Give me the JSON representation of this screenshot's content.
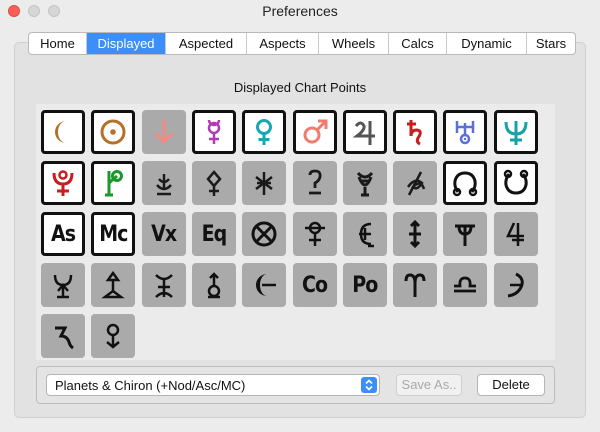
{
  "window": {
    "title": "Preferences"
  },
  "tabs": [
    {
      "label": "Home"
    },
    {
      "label": "Displayed"
    },
    {
      "label": "Aspected"
    },
    {
      "label": "Aspects"
    },
    {
      "label": "Wheels"
    },
    {
      "label": "Calcs"
    },
    {
      "label": "Dynamic"
    },
    {
      "label": "Stars"
    }
  ],
  "active_tab": "Displayed",
  "section": {
    "title": "Displayed Chart Points"
  },
  "chart_points": [
    {
      "symbol": "moon-glyph",
      "enabled": true,
      "color": "#b5702a"
    },
    {
      "symbol": "sun-glyph",
      "enabled": true,
      "color": "#b5702a"
    },
    {
      "symbol": "earth-glyph",
      "enabled": false,
      "color": "#f28a84"
    },
    {
      "symbol": "mercury-glyph",
      "enabled": true,
      "color": "#b23ab5"
    },
    {
      "symbol": "venus-glyph",
      "enabled": true,
      "color": "#1aa7b3"
    },
    {
      "symbol": "mars-glyph",
      "enabled": true,
      "color": "#f07c6e"
    },
    {
      "symbol": "jupiter-glyph",
      "enabled": true,
      "color": "#555555"
    },
    {
      "symbol": "saturn-glyph",
      "enabled": true,
      "color": "#c81e1e"
    },
    {
      "symbol": "uranus-glyph",
      "enabled": true,
      "color": "#5a6fd8"
    },
    {
      "symbol": "neptune-glyph",
      "enabled": true,
      "color": "#17a2a8"
    },
    {
      "symbol": "pluto-glyph",
      "enabled": true,
      "color": "#c81e1e"
    },
    {
      "symbol": "chiron-glyph",
      "enabled": true,
      "color": "#1a9a2a"
    },
    {
      "symbol": "ceres-glyph",
      "enabled": false,
      "color": "#1a1a1a"
    },
    {
      "symbol": "pallas-glyph",
      "enabled": false,
      "color": "#1a1a1a"
    },
    {
      "symbol": "juno-glyph",
      "enabled": false,
      "color": "#1a1a1a"
    },
    {
      "symbol": "vesta-glyph",
      "enabled": false,
      "color": "#1a1a1a"
    },
    {
      "symbol": "lilith-glyph",
      "enabled": false,
      "color": "#1a1a1a"
    },
    {
      "symbol": "fortune-glyph",
      "enabled": false,
      "color": "#1a1a1a"
    },
    {
      "symbol": "north-node-glyph",
      "enabled": true,
      "color": "#111111"
    },
    {
      "symbol": "south-node-glyph",
      "enabled": true,
      "color": "#111111"
    },
    {
      "symbol": "ascendant-glyph",
      "label": "As",
      "enabled": true,
      "color": "#111111"
    },
    {
      "symbol": "midheaven-glyph",
      "label": "Mc",
      "enabled": true,
      "color": "#111111"
    },
    {
      "symbol": "vertex-glyph",
      "label": "Vx",
      "enabled": false,
      "color": "#111111"
    },
    {
      "symbol": "east-point-glyph",
      "label": "Eq",
      "enabled": false,
      "color": "#111111"
    },
    {
      "symbol": "part-glyph",
      "enabled": false,
      "color": "#111111"
    },
    {
      "symbol": "hades-glyph",
      "enabled": false,
      "color": "#111111"
    },
    {
      "symbol": "cupido-glyph",
      "enabled": false,
      "color": "#111111"
    },
    {
      "symbol": "zeus-glyph",
      "enabled": false,
      "color": "#111111"
    },
    {
      "symbol": "kronos-glyph",
      "enabled": false,
      "color": "#111111"
    },
    {
      "symbol": "apollon-glyph",
      "enabled": false,
      "color": "#111111"
    },
    {
      "symbol": "admetos-glyph",
      "enabled": false,
      "color": "#111111"
    },
    {
      "symbol": "vulkanus-glyph",
      "enabled": false,
      "color": "#111111"
    },
    {
      "symbol": "poseidon-glyph",
      "enabled": false,
      "color": "#111111"
    },
    {
      "symbol": "transpluto-glyph",
      "enabled": false,
      "color": "#111111"
    },
    {
      "symbol": "lilith-true-glyph",
      "enabled": false,
      "color": "#111111"
    },
    {
      "symbol": "coascendant-glyph",
      "label": "Co",
      "enabled": false,
      "color": "#111111"
    },
    {
      "symbol": "polar-ascendant-glyph",
      "label": "Po",
      "enabled": false,
      "color": "#111111"
    },
    {
      "symbol": "aries-point-glyph",
      "enabled": false,
      "color": "#111111"
    },
    {
      "symbol": "libra-point-glyph",
      "enabled": false,
      "color": "#111111"
    },
    {
      "symbol": "selena-glyph",
      "enabled": false,
      "color": "#111111"
    },
    {
      "symbol": "hygiea-glyph",
      "enabled": false,
      "color": "#111111"
    },
    {
      "symbol": "psyche-glyph",
      "enabled": false,
      "color": "#111111"
    }
  ],
  "preset": {
    "selected": "Planets & Chiron (+Nod/Asc/MC)"
  },
  "buttons": {
    "save_as": "Save As..",
    "delete": "Delete"
  }
}
